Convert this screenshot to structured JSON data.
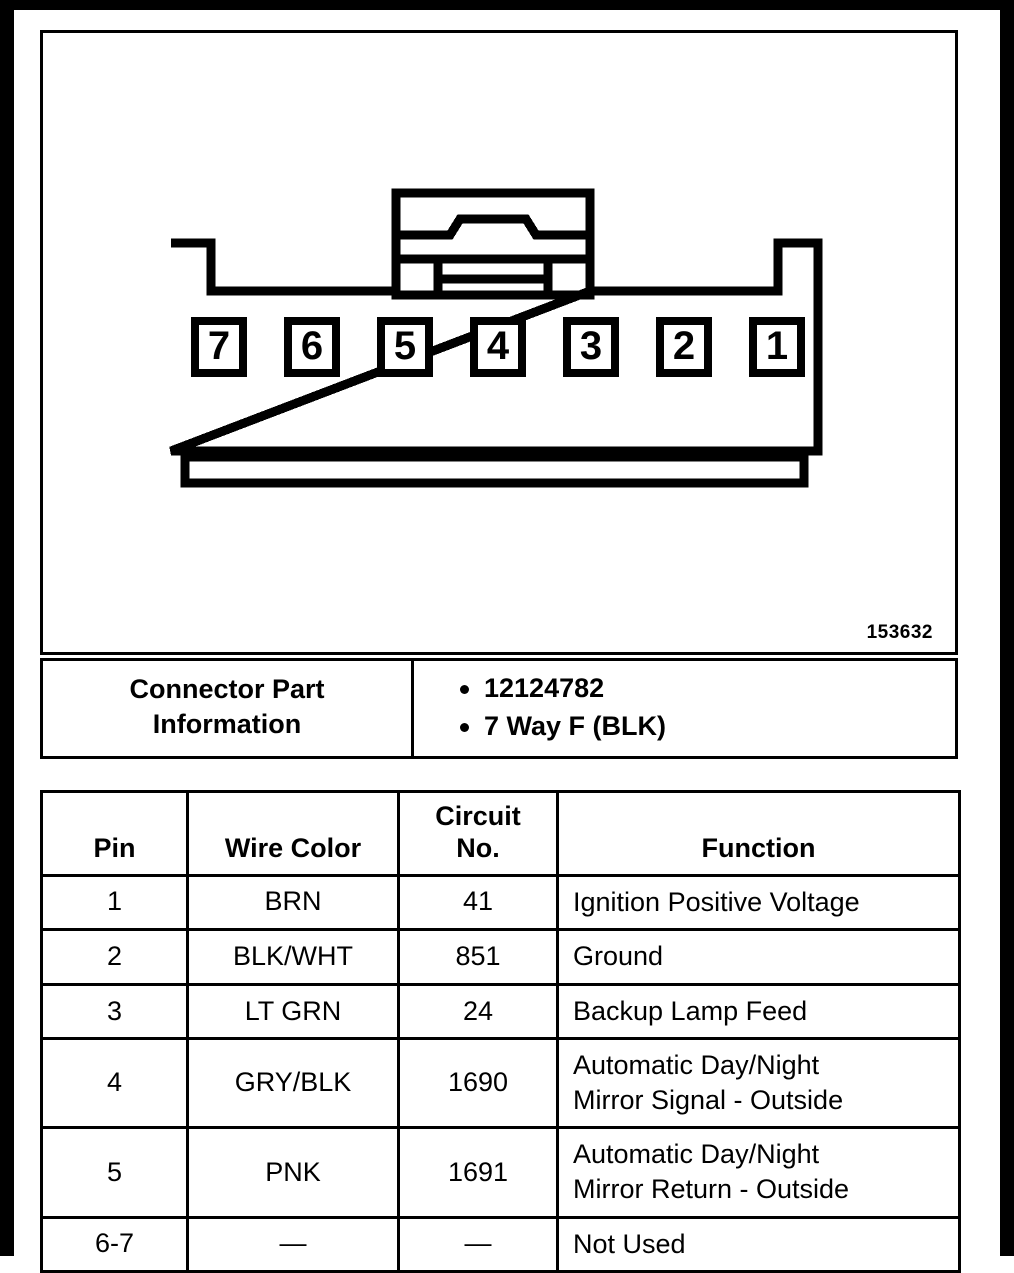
{
  "diagram": {
    "image_number": "153632",
    "pin_labels": [
      "7",
      "6",
      "5",
      "4",
      "3",
      "2",
      "1"
    ],
    "connector_description": "7-way female connector face view"
  },
  "part_info": {
    "label_line1": "Connector Part",
    "label_line2": "Information",
    "values": [
      "12124782",
      "7 Way F (BLK)"
    ]
  },
  "pin_table": {
    "headers": {
      "pin": "Pin",
      "wire_color": "Wire Color",
      "circuit_no_line1": "Circuit",
      "circuit_no_line2": "No.",
      "function": "Function"
    },
    "rows": [
      {
        "pin": "1",
        "wire_color": "BRN",
        "circuit_no": "41",
        "function_line1": "Ignition Positive Voltage",
        "function_line2": ""
      },
      {
        "pin": "2",
        "wire_color": "BLK/WHT",
        "circuit_no": "851",
        "function_line1": "Ground",
        "function_line2": ""
      },
      {
        "pin": "3",
        "wire_color": "LT GRN",
        "circuit_no": "24",
        "function_line1": "Backup Lamp Feed",
        "function_line2": ""
      },
      {
        "pin": "4",
        "wire_color": "GRY/BLK",
        "circuit_no": "1690",
        "function_line1": "Automatic Day/Night",
        "function_line2": "Mirror Signal - Outside"
      },
      {
        "pin": "5",
        "wire_color": "PNK",
        "circuit_no": "1691",
        "function_line1": "Automatic Day/Night",
        "function_line2": "Mirror Return - Outside"
      },
      {
        "pin": "6-7",
        "wire_color": "—",
        "circuit_no": "—",
        "function_line1": "Not Used",
        "function_line2": ""
      }
    ]
  },
  "colors": {
    "ink": "#000000",
    "paper": "#ffffff"
  }
}
